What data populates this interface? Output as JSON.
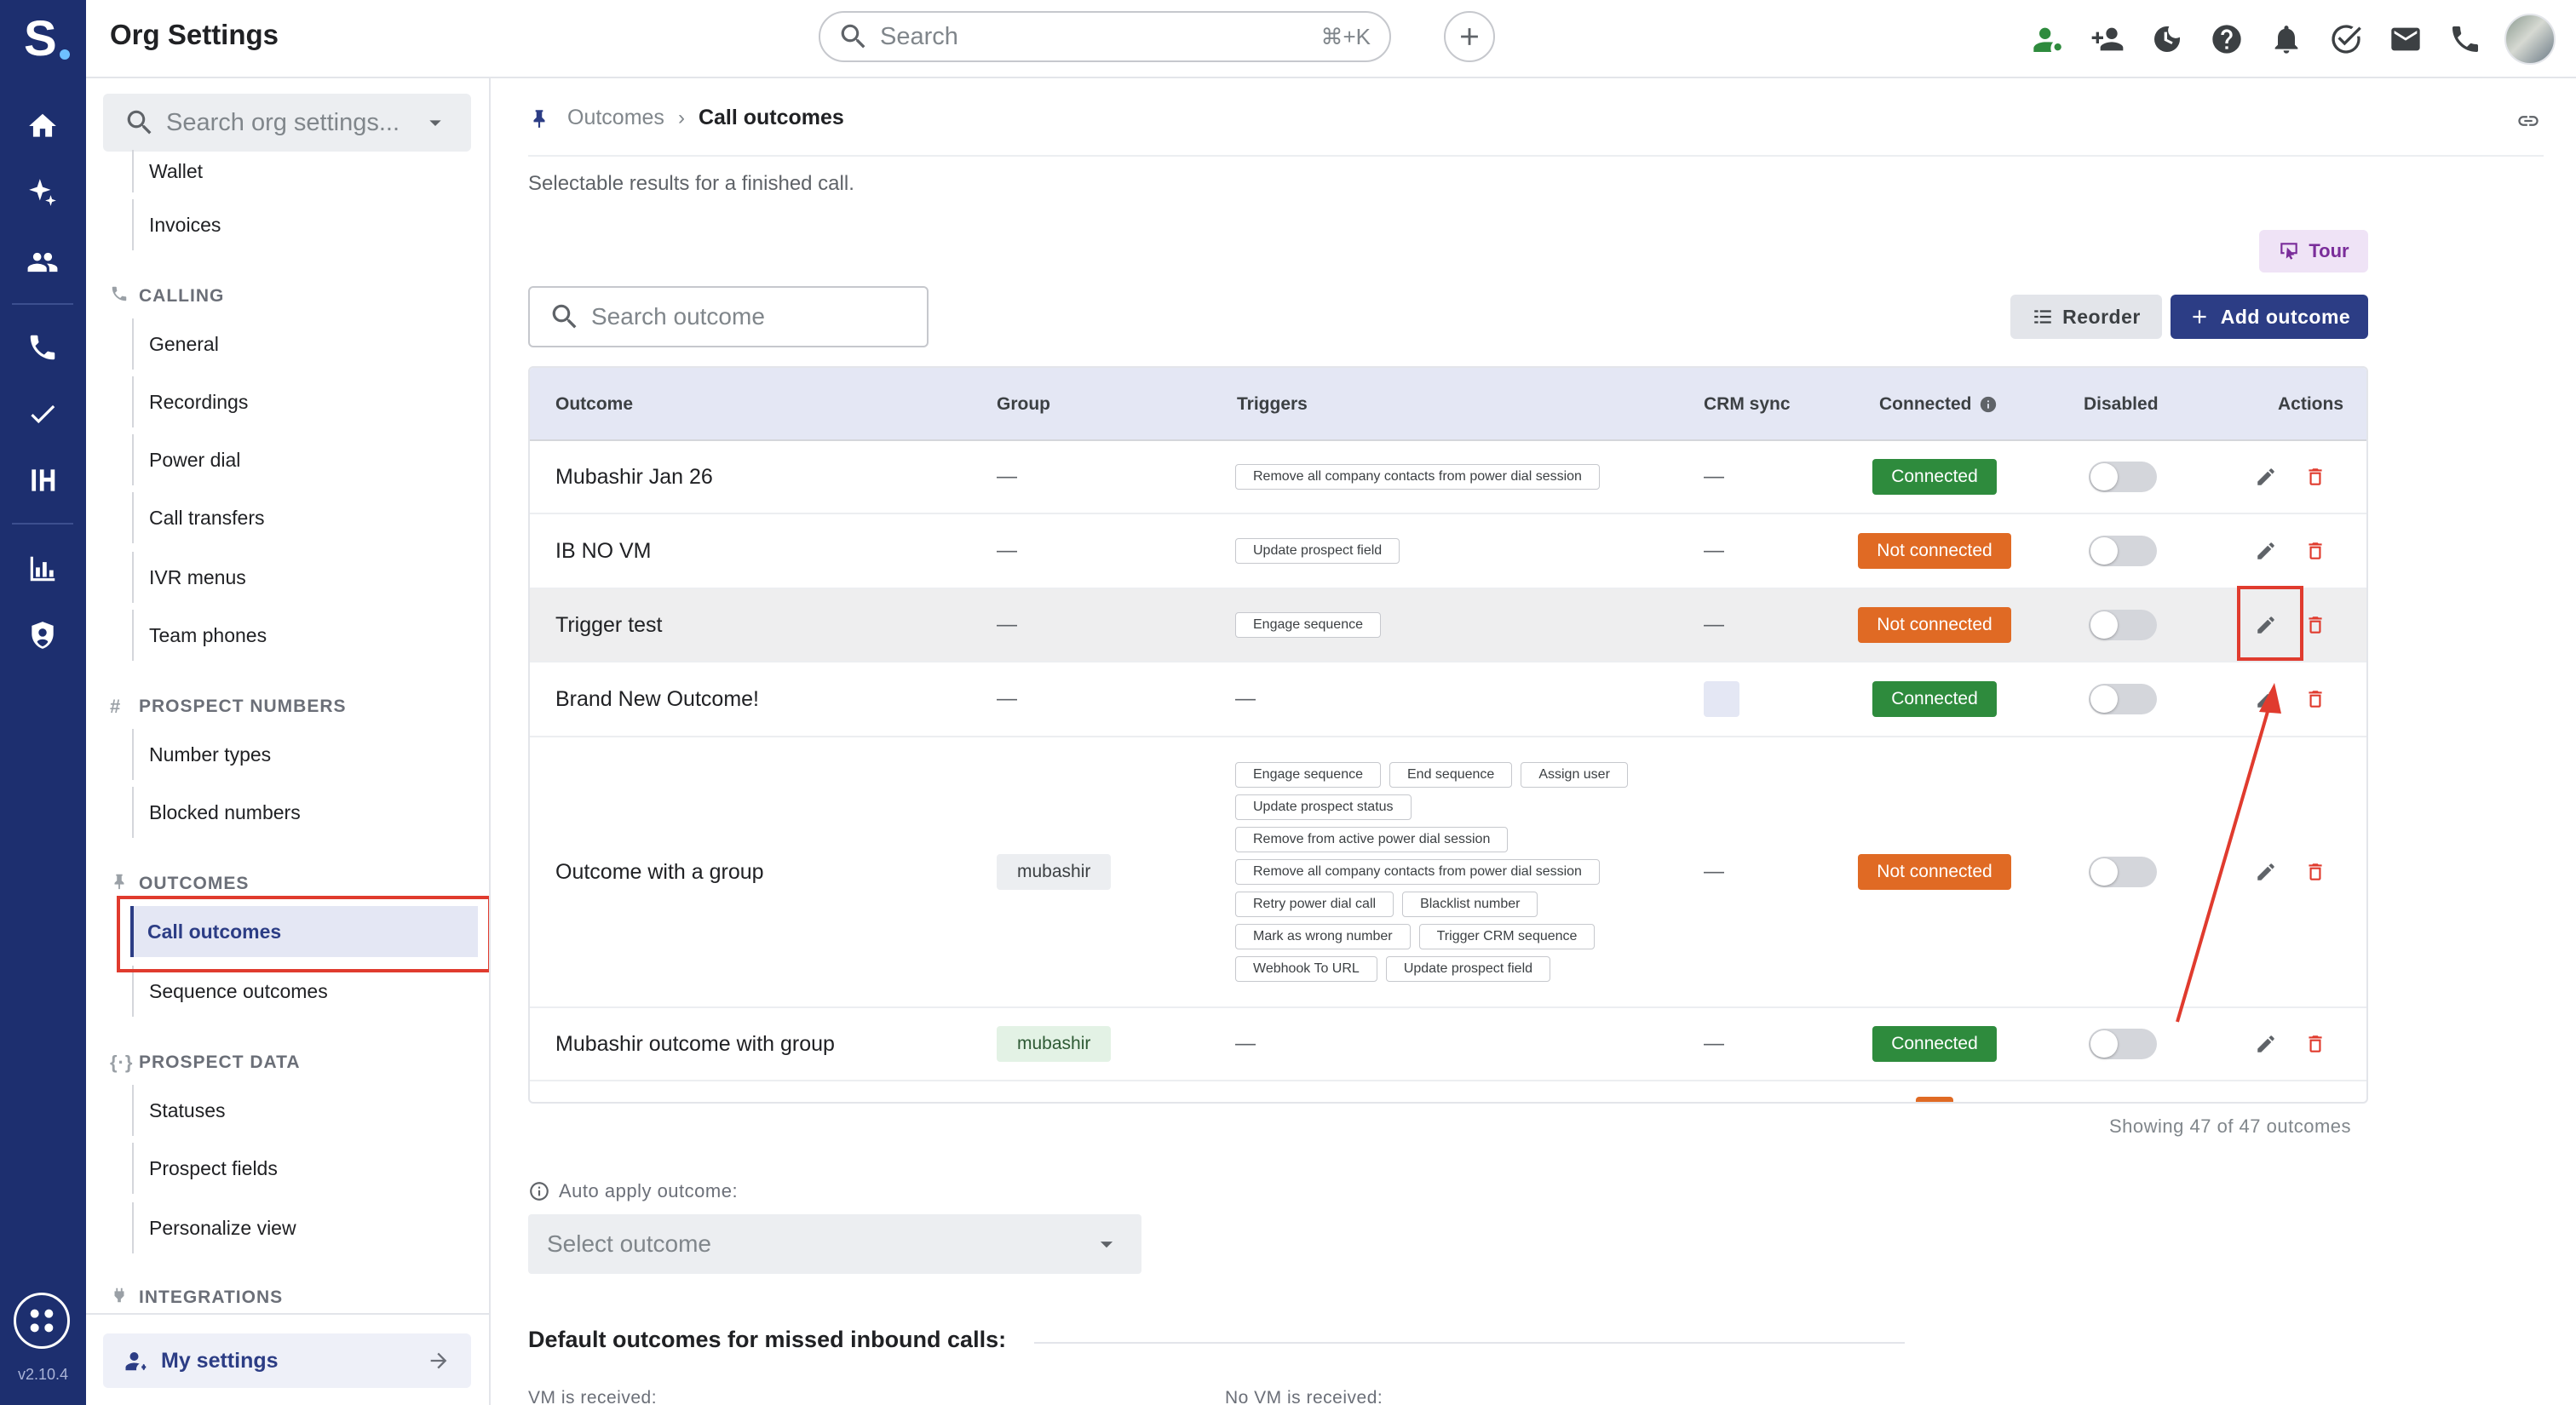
{
  "app": {
    "title": "Org Settings",
    "version": "v2.10.4"
  },
  "topbar": {
    "search_placeholder": "Search",
    "search_shortcut": "⌘+K",
    "icons": [
      "person-status-icon",
      "add-people-icon",
      "dnd-moon-icon",
      "help-icon",
      "bell-icon",
      "tasks-check-icon",
      "mail-icon",
      "phone-icon"
    ]
  },
  "rail": {
    "icons": [
      "home-icon",
      "ai-sparkle-icon",
      "people-icon",
      "phone-icon",
      "check-icon",
      "sequence-icon",
      "analytics-icon",
      "shield-icon"
    ]
  },
  "setnav": {
    "search_placeholder": "Search org settings...",
    "items_top": [
      {
        "label": "Wallet"
      },
      {
        "label": "Invoices"
      }
    ],
    "calling": {
      "title": "CALLING",
      "items": [
        {
          "label": "General"
        },
        {
          "label": "Recordings"
        },
        {
          "label": "Power dial"
        },
        {
          "label": "Call transfers"
        },
        {
          "label": "IVR menus"
        },
        {
          "label": "Team phones"
        }
      ]
    },
    "prospect_numbers": {
      "title": "PROSPECT NUMBERS",
      "items": [
        {
          "label": "Number types"
        },
        {
          "label": "Blocked numbers"
        }
      ]
    },
    "outcomes": {
      "title": "OUTCOMES",
      "items": [
        {
          "label": "Call outcomes",
          "active": true
        },
        {
          "label": "Sequence outcomes"
        }
      ]
    },
    "prospect_data": {
      "title": "PROSPECT DATA",
      "items": [
        {
          "label": "Statuses"
        },
        {
          "label": "Prospect fields"
        },
        {
          "label": "Personalize view"
        }
      ]
    },
    "integrations": {
      "title": "INTEGRATIONS"
    },
    "my_settings_label": "My settings"
  },
  "main": {
    "breadcrumb": {
      "parent": "Outcomes",
      "current": "Call outcomes"
    },
    "description": "Selectable results for a finished call.",
    "tour_label": "Tour",
    "search_placeholder": "Search outcome",
    "reorder_label": "Reorder",
    "add_label": "Add outcome",
    "columns": {
      "outcome": "Outcome",
      "group": "Group",
      "triggers": "Triggers",
      "crm_sync": "CRM sync",
      "connected": "Connected",
      "disabled": "Disabled",
      "actions": "Actions"
    },
    "rows": [
      {
        "name": "Mubashir Jan 26",
        "group": "—",
        "triggers": [
          "Remove all company contacts from power dial session"
        ],
        "crm": "—",
        "connected": "Connected",
        "status": "ok",
        "disabled": false
      },
      {
        "name": "IB NO VM",
        "group": "—",
        "triggers": [
          "Update prospect field"
        ],
        "crm": "—",
        "connected": "Not connected",
        "status": "no",
        "disabled": false
      },
      {
        "name": "Trigger test",
        "group": "—",
        "triggers": [
          "Engage sequence"
        ],
        "crm": "—",
        "connected": "Not connected",
        "status": "no",
        "disabled": false
      },
      {
        "name": "Brand New Outcome!",
        "group": "—",
        "triggers": [],
        "triggers_empty": "—",
        "crm": "",
        "crm_box": true,
        "connected": "Connected",
        "status": "ok",
        "disabled": false
      },
      {
        "name": "Outcome with a group",
        "group_chip": "mubashir",
        "triggers": [
          "Engage sequence",
          "End sequence",
          "Assign user",
          "Update prospect status",
          "Remove from active power dial session",
          "Remove all company contacts from power dial session",
          "Retry power dial call",
          "Blacklist number",
          "Mark as wrong number",
          "Trigger CRM sequence",
          "Webhook To URL",
          "Update prospect field"
        ],
        "crm": "—",
        "connected": "Not connected",
        "status": "no",
        "disabled": false
      },
      {
        "name": "Mubashir outcome with group",
        "group_chip": "mubashir",
        "group_chip_color": "green",
        "triggers": [],
        "triggers_empty": "—",
        "crm": "—",
        "connected": "Connected",
        "status": "ok",
        "disabled": false
      }
    ],
    "showing_text": "Showing 47 of 47 outcomes",
    "auto_apply_label": "Auto apply outcome:",
    "select_placeholder": "Select outcome",
    "missed_title": "Default outcomes for missed inbound calls:",
    "vm_received": "VM is received:",
    "no_vm_received": "No VM is received:"
  },
  "colors": {
    "rail": "#1d2f6f",
    "accent": "#2c3d85",
    "connected": "#2e8b3d",
    "not_connected": "#e06a24",
    "highlight": "#e03b2e"
  }
}
